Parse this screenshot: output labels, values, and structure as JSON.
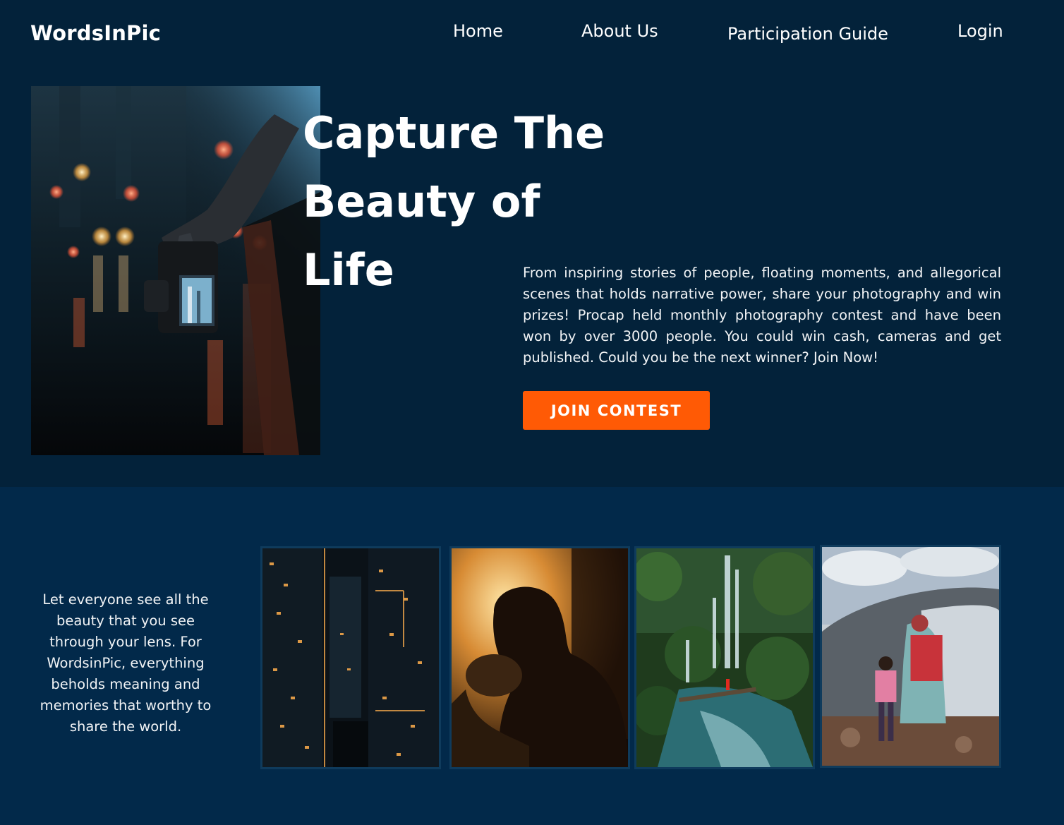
{
  "header": {
    "brand": "WordsInPic",
    "nav": {
      "home": "Home",
      "about": "About Us",
      "guide": "Participation Guide",
      "login": "Login"
    }
  },
  "hero": {
    "title_line1": "Capture The",
    "title_line2": "Beauty of",
    "title_line3": "Life",
    "description": "From inspiring stories of people, floating moments, and allegorical scenes that holds narrative power, share your photography and win prizes! Procap held monthly photography contest and have been won by over 3000 people. You could win cash, cameras and get published. Could you be the next winner? Join Now!",
    "cta_label": "JOIN CONTEST"
  },
  "gallery": {
    "tagline": "Let everyone see all the beauty that you see through your lens. For WordsinPic, everything beholds meaning and memories that worthy to share the world."
  },
  "colors": {
    "background": "#03223a",
    "gallery_background": "#02294a",
    "accent": "#ff5a05",
    "text": "#ffffff"
  }
}
